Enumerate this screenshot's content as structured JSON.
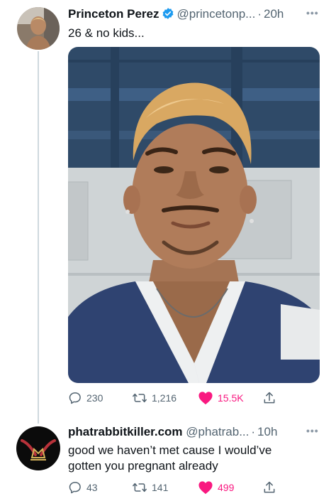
{
  "tweets": [
    {
      "author_name": "Princeton Perez",
      "handle": "@princetonp...",
      "time_sep": "·",
      "time": "20h",
      "text": "26 & no kids...",
      "stats": {
        "replies": "230",
        "retweets": "1,216",
        "likes": "15.5K"
      },
      "verified": true,
      "liked": true
    },
    {
      "author_name": "phatrabbitkiller.com",
      "handle": "@phatrab...",
      "time_sep": "·",
      "time": "10h",
      "text_lines": [
        "good we haven’t met cause I would’ve",
        "gotten you pregnant already"
      ],
      "stats": {
        "replies": "43",
        "retweets": "141",
        "likes": "499"
      },
      "verified": false,
      "liked": true
    }
  ],
  "colors": {
    "like": "#f91880",
    "verified": "#1d9bf0",
    "secondary_text": "#536471",
    "thread_line": "#cfd9de"
  },
  "icons": [
    "reply-icon",
    "retweet-icon",
    "heart-icon",
    "share-icon",
    "verified-badge-icon",
    "more-options-icon"
  ]
}
